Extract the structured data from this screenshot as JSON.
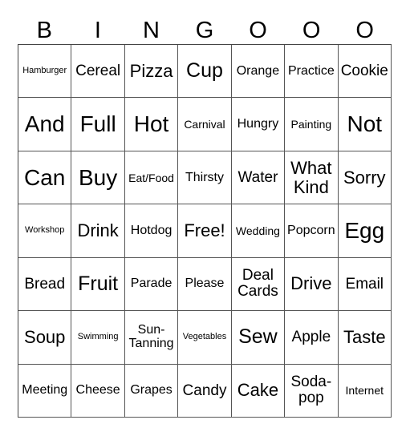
{
  "header": [
    "B",
    "I",
    "N",
    "G",
    "O",
    "O",
    "O"
  ],
  "cells": [
    [
      "Hamburger",
      "Cereal",
      "Pizza",
      "Cup",
      "Orange",
      "Practice",
      "Cookie"
    ],
    [
      "And",
      "Full",
      "Hot",
      "Carnival",
      "Hungry",
      "Painting",
      "Not"
    ],
    [
      "Can",
      "Buy",
      "Eat/Food",
      "Thirsty",
      "Water",
      "What Kind",
      "Sorry"
    ],
    [
      "Workshop",
      "Drink",
      "Hotdog",
      "Free!",
      "Wedding",
      "Popcorn",
      "Egg"
    ],
    [
      "Bread",
      "Fruit",
      "Parade",
      "Please",
      "Deal Cards",
      "Drive",
      "Email"
    ],
    [
      "Soup",
      "Swimming",
      "Sun-Tanning",
      "Vegetables",
      "Sew",
      "Apple",
      "Taste"
    ],
    [
      "Meeting",
      "Cheese",
      "Grapes",
      "Candy",
      "Cake",
      "Soda-pop",
      "Internet"
    ]
  ]
}
